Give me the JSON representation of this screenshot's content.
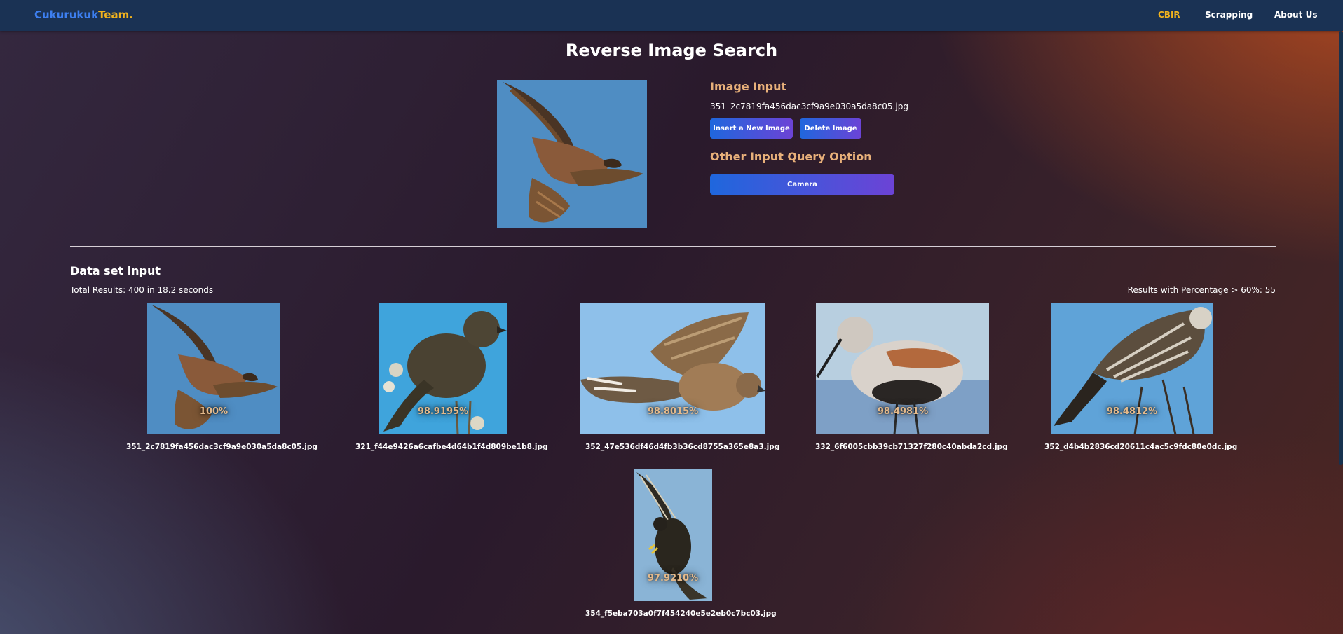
{
  "navbar": {
    "brand_part1": "Cukurukuk",
    "brand_part2": "Team.",
    "links": [
      {
        "label": "CBIR",
        "active": true
      },
      {
        "label": "Scrapping",
        "active": false
      },
      {
        "label": "About Us",
        "active": false
      }
    ]
  },
  "page_title": "Reverse Image Search",
  "query": {
    "image_icon": "hawk-photo",
    "input_heading": "Image Input",
    "filename": "351_2c7819fa456dac3cf9a9e030a5da8c05.jpg",
    "insert_label": "Insert a New Image",
    "delete_label": "Delete Image",
    "other_heading": "Other Input Query Option",
    "camera_label": "Camera"
  },
  "dataset": {
    "title": "Data set input",
    "total": "Total Results: 400 in 18.2 seconds",
    "threshold": "Results with Percentage > 60%: 55"
  },
  "results": [
    {
      "percentage": "100%",
      "filename": "351_2c7819fa456dac3cf9a9e030a5da8c05.jpg"
    },
    {
      "percentage": "98.9195%",
      "filename": "321_f44e9426a6cafbe4d64b1f4d809be1b8.jpg"
    },
    {
      "percentage": "98.8015%",
      "filename": "352_47e536df46d4fb3b36cd8755a365e8a3.jpg"
    },
    {
      "percentage": "98.4981%",
      "filename": "332_6f6005cbb39cb71327f280c40abda2cd.jpg"
    },
    {
      "percentage": "98.4812%",
      "filename": "352_d4b4b2836cd20611c4ac5c9fdc80e0dc.jpg"
    },
    {
      "percentage": "97.9210%",
      "filename": "354_f5eba703a0f7f454240e5e2eb0c7bc03.jpg"
    }
  ],
  "colors": {
    "navbar": "#1a3254",
    "accent": "#f0b21e",
    "brand_blue": "#3d7ff0",
    "heading_peach": "#e8b07a",
    "button_from": "#1f67dd",
    "button_to": "#6c43d6"
  }
}
